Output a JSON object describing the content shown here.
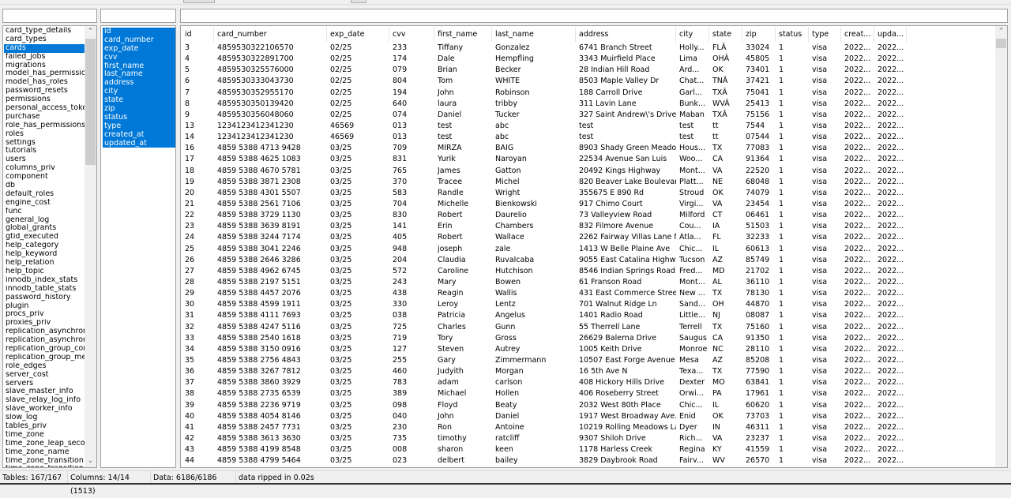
{
  "filters": {
    "tables": "",
    "columns": "",
    "data": ""
  },
  "tables": {
    "selected": "cards",
    "items": [
      "card_type_details",
      "card_types",
      "cards",
      "failed_jobs",
      "migrations",
      "model_has_permissions",
      "model_has_roles",
      "password_resets",
      "permissions",
      "personal_access_tokens",
      "purchase",
      "role_has_permissions",
      "roles",
      "settings",
      "tutorials",
      "users",
      "columns_priv",
      "component",
      "db",
      "default_roles",
      "engine_cost",
      "func",
      "general_log",
      "global_grants",
      "gtid_executed",
      "help_category",
      "help_keyword",
      "help_relation",
      "help_topic",
      "innodb_index_stats",
      "innodb_table_stats",
      "password_history",
      "plugin",
      "procs_priv",
      "proxies_priv",
      "replication_asynchronous",
      "replication_asynchronous",
      "replication_group_configu",
      "replication_group_membe",
      "role_edges",
      "server_cost",
      "servers",
      "slave_master_info",
      "slave_relay_log_info",
      "slave_worker_info",
      "slow_log",
      "tables_priv",
      "time_zone",
      "time_zone_leap_second",
      "time_zone_name",
      "time_zone_transition",
      "time_zone_transition_typ"
    ]
  },
  "columns": [
    "id",
    "card_number",
    "exp_date",
    "cvv",
    "first_name",
    "last_name",
    "address",
    "city",
    "state",
    "zip",
    "status",
    "type",
    "created_at",
    "updated_at"
  ],
  "grid": {
    "headers": [
      "id",
      "card_number",
      "exp_date",
      "cvv",
      "first_name",
      "last_name",
      "address",
      "city",
      "state",
      "zip",
      "status",
      "type",
      "creat...",
      "upda..."
    ],
    "rows": [
      [
        "3",
        "4859530322106570",
        "02/25",
        "233",
        "Tiffany",
        "Gonzalez",
        "6741 Branch Street",
        "Holly...",
        "FLÂ",
        "33024",
        "1",
        "visa",
        "2022...",
        "2022..."
      ],
      [
        "4",
        "4859530322891700",
        "02/25",
        "174",
        "Dale",
        "Hempfling",
        "3343 Muirfield Place",
        "Lima",
        "OHÂ",
        "45805",
        "1",
        "visa",
        "2022...",
        "2022..."
      ],
      [
        "5",
        "4859530325576000",
        "02/25",
        "079",
        "Brian",
        "Becker",
        "28 Indian Hill Road",
        "Ard...",
        "OK",
        "73401",
        "1",
        "visa",
        "2022...",
        "2022..."
      ],
      [
        "6",
        "4859530333043730",
        "02/25",
        "804",
        "Tom",
        "WHITE",
        "8503 Maple Valley Dr",
        "Chat...",
        "TNÂ",
        "37421",
        "1",
        "visa",
        "2022...",
        "2022..."
      ],
      [
        "7",
        "4859530352955170",
        "02/25",
        "194",
        "John",
        "Robinson",
        "188 Carroll Drive",
        "Garl...",
        "TXÂ",
        "75041",
        "1",
        "visa",
        "2022...",
        "2022..."
      ],
      [
        "8",
        "4859530350139420",
        "02/25",
        "640",
        "laura",
        "tribby",
        "311 Lavin Lane",
        "Bunk...",
        "WVÂ",
        "25413",
        "1",
        "visa",
        "2022...",
        "2022..."
      ],
      [
        "9",
        "4859530356048060",
        "02/25",
        "074",
        "Daniel",
        "Tucker",
        "327 Saint Andrew\\'s Drive",
        "Maban",
        "TXÂ",
        "75156",
        "1",
        "visa",
        "2022...",
        "2022..."
      ],
      [
        "13",
        "1234123412341230",
        "46569",
        "013",
        "test",
        "abc",
        "test",
        "test",
        "tt",
        "7544",
        "1",
        "visa",
        "2022...",
        "2022..."
      ],
      [
        "14",
        "1234123412341230",
        "46569",
        "013",
        "test",
        "abc",
        "test",
        "test",
        "tt",
        "07544",
        "1",
        "visa",
        "2022...",
        "2022..."
      ],
      [
        "16",
        "4859 5388 4713 9428",
        "03/25",
        "709",
        "MIRZA",
        "BAIG",
        "8903 Shady Green Meadows",
        "Hous...",
        "TX",
        "77083",
        "1",
        "visa",
        "2022...",
        "2022..."
      ],
      [
        "17",
        "4859 5388 4625 1083",
        "03/25",
        "831",
        "Yurik",
        "Naroyan",
        "22534 Avenue San Luis",
        "Woo...",
        "CA",
        "91364",
        "1",
        "visa",
        "2022...",
        "2022..."
      ],
      [
        "18",
        "4859 5388 4670 5781",
        "03/25",
        "765",
        "James",
        "Gatton",
        "20492 Kings Highway",
        "Mont...",
        "VA",
        "22520",
        "1",
        "visa",
        "2022...",
        "2022..."
      ],
      [
        "19",
        "4859 5388 3871 2308",
        "03/25",
        "370",
        "Tracee",
        "Michel",
        "820 Beaver Lake Boulevard",
        "Platt...",
        "NE",
        "68048",
        "1",
        "visa",
        "2022...",
        "2022..."
      ],
      [
        "20",
        "4859 5388 4301 5507",
        "03/25",
        "583",
        "Randle",
        "Wright",
        "355675 E 890 Rd",
        "Stroud",
        "OK",
        "74079",
        "1",
        "visa",
        "2022...",
        "2022..."
      ],
      [
        "21",
        "4859 5388 2561 7106",
        "03/25",
        "704",
        "Michelle",
        "Bienkowski",
        "917 Chimo Court",
        "Virgi...",
        "VA",
        "23454",
        "1",
        "visa",
        "2022...",
        "2022..."
      ],
      [
        "22",
        "4859 5388 3729 1130",
        "03/25",
        "830",
        "Robert",
        "Daurelio",
        "73 Valleyview Road",
        "Milford",
        "CT",
        "06461",
        "1",
        "visa",
        "2022...",
        "2022..."
      ],
      [
        "23",
        "4859 5388 3639 8191",
        "03/25",
        "141",
        "Erin",
        "Chambers",
        "832 Filmore Avenue",
        "Cou...",
        "IA",
        "51503",
        "1",
        "visa",
        "2022...",
        "2022..."
      ],
      [
        "24",
        "4859 5388 3244 7174",
        "03/25",
        "405",
        "Robert",
        "Wallace",
        "2262 Fairway Villas Lane N...",
        "Atla...",
        "FL",
        "32233",
        "1",
        "visa",
        "2022...",
        "2022..."
      ],
      [
        "25",
        "4859 5388 3041 2246",
        "03/25",
        "948",
        "joseph",
        "zale",
        "1413 W Belle Plaine Ave",
        "Chic...",
        "IL",
        "60613",
        "1",
        "visa",
        "2022...",
        "2022..."
      ],
      [
        "26",
        "4859 5388 2646 3286",
        "03/25",
        "204",
        "Claudia",
        "Ruvalcaba",
        "9055 East Catalina Highway",
        "Tucson",
        "AZ",
        "85749",
        "1",
        "visa",
        "2022...",
        "2022..."
      ],
      [
        "27",
        "4859 5388 4962 6745",
        "03/25",
        "572",
        "Caroline",
        "Hutchison",
        "8546 Indian Springs Road",
        "Fred...",
        "MD",
        "21702",
        "1",
        "visa",
        "2022...",
        "2022..."
      ],
      [
        "28",
        "4859 5388 2197 5151",
        "03/25",
        "243",
        "Mary",
        "Bowen",
        "61 Franson Road",
        "Mont...",
        "AL",
        "36110",
        "1",
        "visa",
        "2022...",
        "2022..."
      ],
      [
        "29",
        "4859 5388 4457 2076",
        "03/25",
        "438",
        "Reagin",
        "Wallis",
        "431 East Commerce Street",
        "New ...",
        "TX",
        "78130",
        "1",
        "visa",
        "2022...",
        "2022..."
      ],
      [
        "30",
        "4859 5388 4599 1911",
        "03/25",
        "330",
        "Leroy",
        "Lentz",
        "701 Walnut Ridge Ln",
        "Sand...",
        "OH",
        "44870",
        "1",
        "visa",
        "2022...",
        "2022..."
      ],
      [
        "31",
        "4859 5388 4111 7693",
        "03/25",
        "038",
        "Patricia",
        "Angelus",
        "1401 Radio Road",
        "Little...",
        "NJ",
        "08087",
        "1",
        "visa",
        "2022...",
        "2022..."
      ],
      [
        "32",
        "4859 5388 4247 5116",
        "03/25",
        "725",
        "Charles",
        "Gunn",
        "55 Therrell Lane",
        "Terrell",
        "TX",
        "75160",
        "1",
        "visa",
        "2022...",
        "2022..."
      ],
      [
        "33",
        "4859 5388 2540 1618",
        "03/25",
        "719",
        "Tory",
        "Gross",
        "26629 Balerna Drive",
        "Saugus",
        "CA",
        "91350",
        "1",
        "visa",
        "2022...",
        "2022..."
      ],
      [
        "34",
        "4859 5388 3150 0916",
        "03/25",
        "127",
        "Steven",
        "Autrey",
        "1005 Keith Drive",
        "Monroe",
        "NC",
        "28110",
        "1",
        "visa",
        "2022...",
        "2022..."
      ],
      [
        "35",
        "4859 5388 2756 4843",
        "03/25",
        "255",
        "Gary",
        "Zimmermann",
        "10507 East Forge Avenue",
        "Mesa",
        "AZ",
        "85208",
        "1",
        "visa",
        "2022...",
        "2022..."
      ],
      [
        "36",
        "4859 5388 3267 7812",
        "03/25",
        "460",
        "Judyith",
        "Morgan",
        "16 5th Ave N",
        "Texa...",
        "TX",
        "77590",
        "1",
        "visa",
        "2022...",
        "2022..."
      ],
      [
        "37",
        "4859 5388 3860 3929",
        "03/25",
        "783",
        "adam",
        "carlson",
        "408 Hickory Hills Drive",
        "Dexter",
        "MO",
        "63841",
        "1",
        "visa",
        "2022...",
        "2022..."
      ],
      [
        "38",
        "4859 5388 2735 6539",
        "03/25",
        "389",
        "Michael",
        "Hollen",
        "406 Roseberry Street",
        "Orwi...",
        "PA",
        "17961",
        "1",
        "visa",
        "2022...",
        "2022..."
      ],
      [
        "39",
        "4859 5388 2236 9719",
        "03/25",
        "098",
        "Floyd",
        "Beaty",
        "2032 West 80th Place",
        "Chic...",
        "IL",
        "60620",
        "1",
        "visa",
        "2022...",
        "2022..."
      ],
      [
        "40",
        "4859 5388 4054 8146",
        "03/25",
        "040",
        "John",
        "Daniel",
        "1917 West Broadway Ave...",
        "Enid",
        "OK",
        "73703",
        "1",
        "visa",
        "2022...",
        "2022..."
      ],
      [
        "41",
        "4859 5388 2457 7731",
        "03/25",
        "230",
        "Ron",
        "Antoine",
        "10219 Rolling Meadows Lane",
        "Dyer",
        "IN",
        "46311",
        "1",
        "visa",
        "2022...",
        "2022..."
      ],
      [
        "42",
        "4859 5388 3613 3630",
        "03/25",
        "735",
        "timothy",
        "ratcliff",
        "9307 Shiloh Drive",
        "Rich...",
        "VA",
        "23237",
        "1",
        "visa",
        "2022...",
        "2022..."
      ],
      [
        "43",
        "4859 5388 4199 8548",
        "03/25",
        "008",
        "sharon",
        "keen",
        "1178 Harless Creek",
        "Regina",
        "KY",
        "41559",
        "1",
        "visa",
        "2022...",
        "2022..."
      ],
      [
        "44",
        "4859 5388 4799 5464",
        "03/25",
        "023",
        "delbert",
        "bailey",
        "3829 Daybrook Road",
        "Fairv...",
        "WV",
        "26570",
        "1",
        "visa",
        "2022...",
        "2022..."
      ]
    ]
  },
  "status": {
    "tables": "Tables: 167/167",
    "columns": "Columns: 14/14 (1513)",
    "data": "Data: 6186/6186",
    "message": "data ripped in 0.02s"
  },
  "colors": {
    "selection": "#0078d7"
  }
}
